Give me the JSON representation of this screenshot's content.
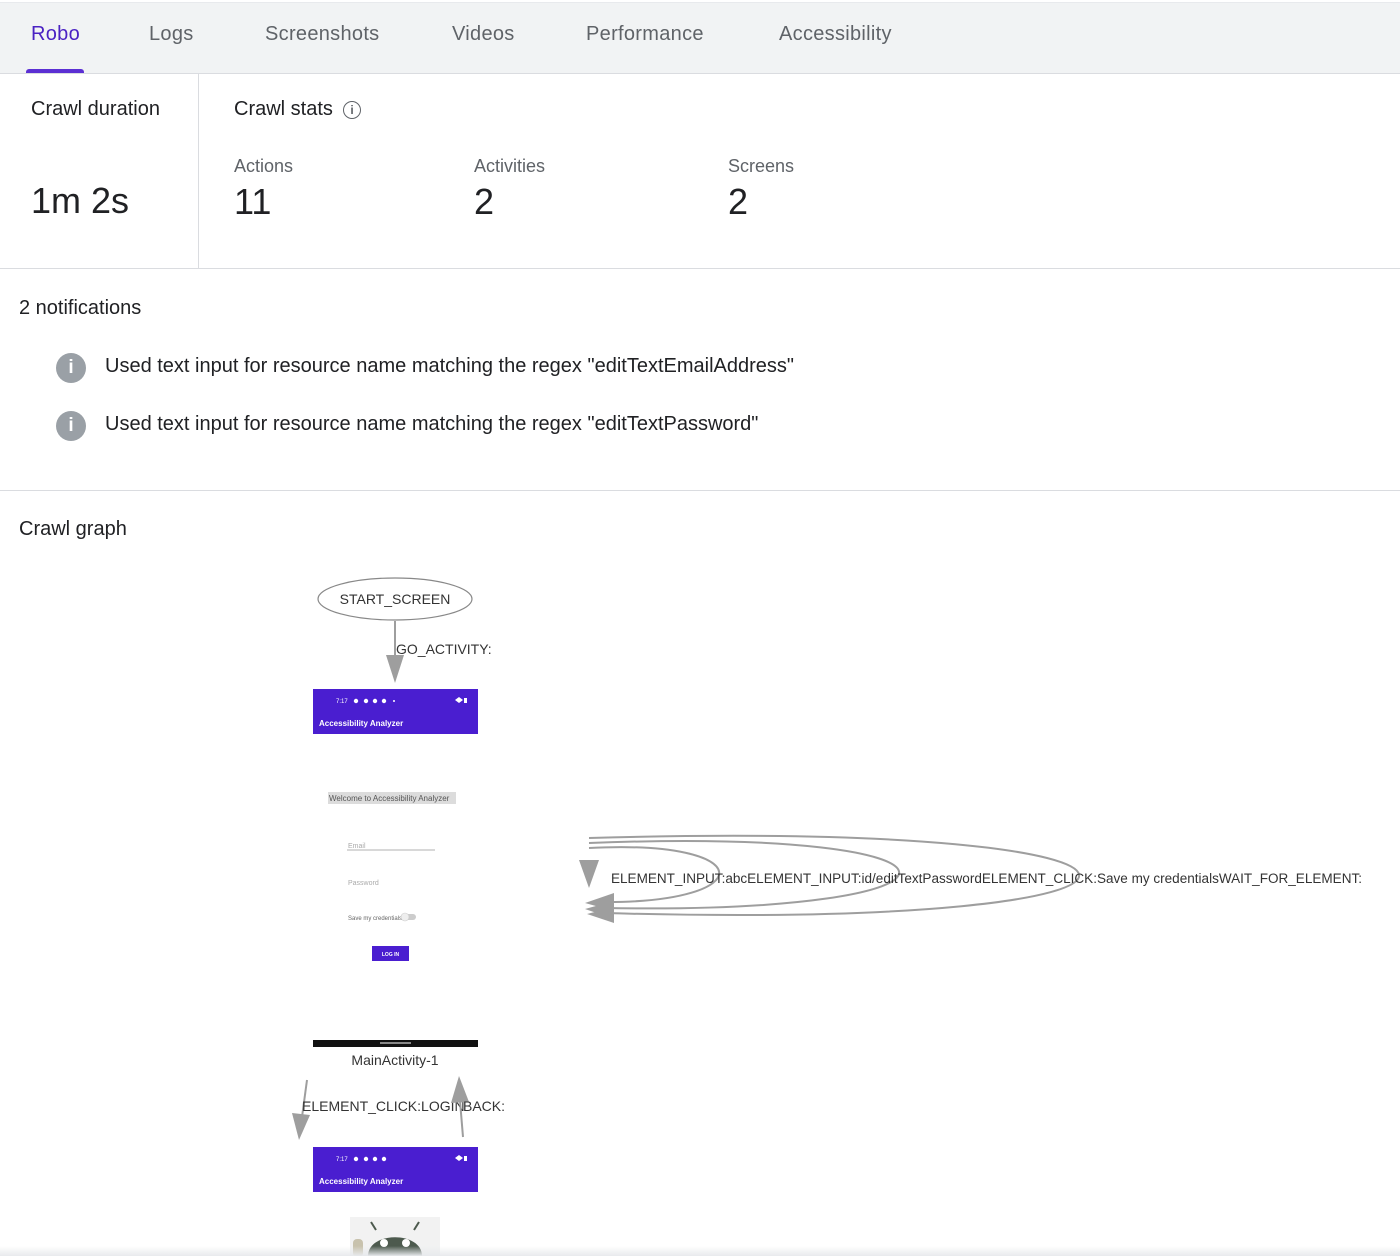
{
  "tabs": [
    {
      "label": "Robo",
      "active": true
    },
    {
      "label": "Logs",
      "active": false
    },
    {
      "label": "Screenshots",
      "active": false
    },
    {
      "label": "Videos",
      "active": false
    },
    {
      "label": "Performance",
      "active": false
    },
    {
      "label": "Accessibility",
      "active": false
    }
  ],
  "crawl_duration": {
    "title": "Crawl duration",
    "value": "1m 2s"
  },
  "crawl_stats": {
    "title": "Crawl stats",
    "info_icon": "info-outline-icon",
    "items": [
      {
        "label": "Actions",
        "value": "11"
      },
      {
        "label": "Activities",
        "value": "2"
      },
      {
        "label": "Screens",
        "value": "2"
      }
    ]
  },
  "notifications": {
    "title": "2 notifications",
    "icon": "info-filled-icon",
    "items": [
      {
        "text": "Used text input for resource name matching the regex \"editTextEmailAddress\""
      },
      {
        "text": "Used text input for resource name matching the regex \"editTextPassword\""
      }
    ]
  },
  "crawl_graph": {
    "title": "Crawl graph",
    "start_node": "START_SCREEN",
    "edge_start": "GO_ACTIVITY:",
    "screen1": {
      "app_bar_title": "Accessibility Analyzer",
      "status_time": "7:17",
      "welcome": "Welcome to Accessibility Analyzer",
      "email_hint": "Email",
      "password_hint": "Password",
      "save_label": "Save my credentials",
      "login_button": "LOG IN",
      "node_label": "MainActivity-1"
    },
    "self_loop_label": "ELEMENT_INPUT:abcELEMENT_INPUT:id/editTextPasswordELEMENT_CLICK:Save my credentialsWAIT_FOR_ELEMENT:",
    "edge_down_label": "ELEMENT_CLICK:LOGIN",
    "edge_up_label": "BACK:",
    "screen2": {
      "app_bar_title": "Accessibility Analyzer",
      "status_time": "7:17"
    },
    "colors": {
      "app_bar": "#4a1ed0",
      "accent": "#5b2fd3",
      "edge": "#9e9e9e"
    }
  }
}
